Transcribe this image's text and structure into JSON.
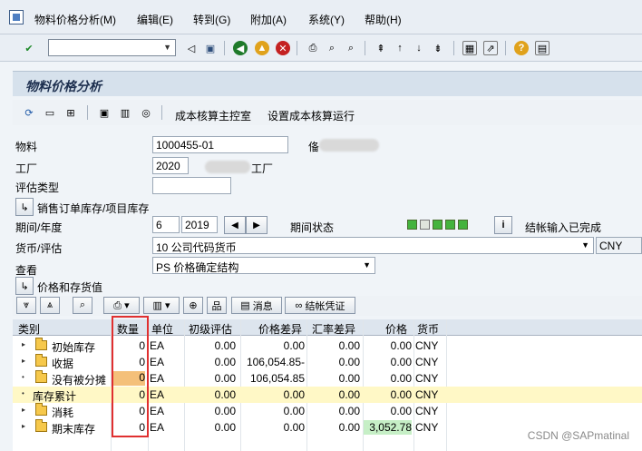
{
  "menu": [
    "物料价格分析(M)",
    "编辑(E)",
    "转到(G)",
    "附加(A)",
    "系统(Y)",
    "帮助(H)"
  ],
  "toolbar": {
    "command_value": ""
  },
  "title": "物料价格分析",
  "app_toolbar": {
    "cost_cockpit": "成本核算主控室",
    "set_run": "设置成本核算运行"
  },
  "form": {
    "material_label": "物料",
    "material_value": "1000455-01",
    "material_desc_prefix": "俻",
    "plant_label": "工厂",
    "plant_value": "2020",
    "plant_suffix": "工厂",
    "valuation_type_label": "评估类型",
    "valuation_type_value": "",
    "sales_order_btn": "销售订单库存/项目库存",
    "period_label": "期间/年度",
    "period_value": "6",
    "year_value": "2019",
    "period_status_label": "期间状态",
    "closing_status": "结帐输入已完成",
    "currency_label": "货币/评估",
    "currency_value": "10 公司代码货币",
    "currency_code": "CNY",
    "view_label": "查看",
    "view_value": "PS 价格确定结构",
    "price_stock_btn": "价格和存货值"
  },
  "grid_toolbar": {
    "message_btn": "消息",
    "closing_btn": "结帐凭证"
  },
  "grid": {
    "columns": [
      "类别",
      "数量",
      "单位",
      "初级评估",
      "价格差异",
      "汇率差异",
      "价格",
      "货币"
    ],
    "rows": [
      {
        "category": "初始库存",
        "qty": "0",
        "unit": "EA",
        "primary": "0.00",
        "price_var": "0.00",
        "fx_var": "0.00",
        "price": "0.00",
        "currency": "CNY",
        "marker": "▸",
        "folder": true,
        "highlight": false
      },
      {
        "category": "收据",
        "qty": "0",
        "unit": "EA",
        "primary": "0.00",
        "price_var": "106,054.85-",
        "fx_var": "0.00",
        "price": "0.00",
        "currency": "CNY",
        "marker": "▸",
        "folder": true,
        "highlight": false
      },
      {
        "category": "没有被分摊",
        "qty": "0",
        "unit": "EA",
        "primary": "0.00",
        "price_var": "106,054.85",
        "fx_var": "0.00",
        "price": "0.00",
        "currency": "CNY",
        "marker": "•",
        "folder": true,
        "highlight": false
      },
      {
        "category": "库存累计",
        "qty": "0",
        "unit": "EA",
        "primary": "0.00",
        "price_var": "0.00",
        "fx_var": "0.00",
        "price": "0.00",
        "currency": "CNY",
        "marker": "•",
        "folder": false,
        "highlight": true
      },
      {
        "category": "消耗",
        "qty": "0",
        "unit": "EA",
        "primary": "0.00",
        "price_var": "0.00",
        "fx_var": "0.00",
        "price": "0.00",
        "currency": "CNY",
        "marker": "▸",
        "folder": true,
        "highlight": false
      },
      {
        "category": "期末库存",
        "qty": "0",
        "unit": "EA",
        "primary": "0.00",
        "price_var": "0.00",
        "fx_var": "0.00",
        "price": "3,052.78",
        "currency": "CNY",
        "marker": "▸",
        "folder": true,
        "highlight": false
      }
    ]
  },
  "watermark": "CSDN @SAPmatinal"
}
